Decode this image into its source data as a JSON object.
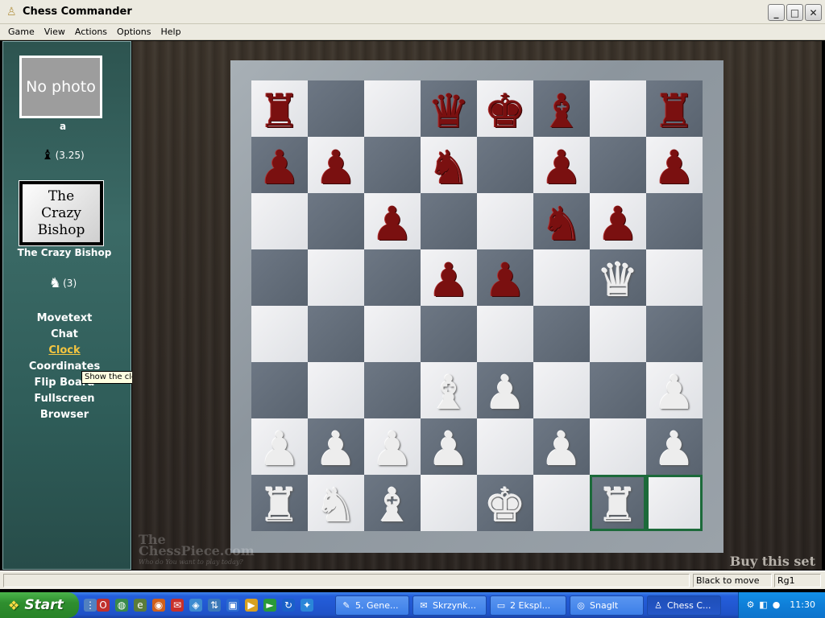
{
  "window": {
    "title": "Chess Commander",
    "controls": {
      "minimize": "_",
      "maximize": "□",
      "close": "✕"
    }
  },
  "menu": [
    "Game",
    "View",
    "Actions",
    "Options",
    "Help"
  ],
  "player1": {
    "photo_text": "No photo",
    "name": "a",
    "score": "(3.25)",
    "piece_icon": "bishop-icon"
  },
  "player2": {
    "picture_text": "The\nCrazy\nBishop",
    "name": "The Crazy Bishop",
    "score": "(3)",
    "piece_icon": "knight-icon"
  },
  "side_links": [
    "Movetext",
    "Chat",
    "Clock",
    "Coordinates",
    "Flip Board",
    "Fullscreen",
    "Browser"
  ],
  "active_link": "Clock",
  "tooltip": "Show the clock",
  "board": {
    "ranks": [
      [
        "r",
        "",
        "",
        "q",
        "k",
        "b",
        "",
        "r"
      ],
      [
        "p",
        "p",
        "",
        "n",
        "",
        "p",
        "",
        "p"
      ],
      [
        "",
        "",
        "p",
        "",
        "",
        "n",
        "p",
        ""
      ],
      [
        "",
        "",
        "",
        "p",
        "p",
        "",
        "Q",
        ""
      ],
      [
        "",
        "",
        "",
        "",
        "",
        "",
        "",
        ""
      ],
      [
        "",
        "",
        "",
        "B",
        "P",
        "",
        "",
        "P"
      ],
      [
        "P",
        "P",
        "P",
        "P",
        "",
        "P",
        "",
        "P"
      ],
      [
        "R",
        "N",
        "B",
        "",
        "K",
        "",
        "R",
        ""
      ]
    ],
    "highlight_squares": [
      "g1",
      "h1"
    ],
    "colors": {
      "highlight": "#1c6a3a",
      "black_pieces": "#7a1010",
      "white_pieces": "#ededed"
    }
  },
  "watermark": {
    "title": "The",
    "brand": "ChessPiece.com",
    "tagline": "Who do You want to play today?"
  },
  "buy_set": "Buy this set",
  "status": {
    "to_move": "Black to move",
    "last_move": "Rg1"
  },
  "taskbar": {
    "start": "Start",
    "quick_launch": [
      "opera-icon",
      "globe-icon",
      "ie-icon",
      "firefox-icon",
      "mail-icon",
      "vlc-icon",
      "ftp-icon",
      "folder-icon",
      "media-icon",
      "messenger-icon"
    ],
    "tasks": [
      {
        "label": "5. Gene...",
        "icon": "document-icon"
      },
      {
        "label": "Skrzynk...",
        "icon": "mail-icon"
      },
      {
        "label": "2 Ekspl...",
        "icon": "folder-icon"
      },
      {
        "label": "SnagIt",
        "icon": "snagit-icon"
      },
      {
        "label": "Chess C...",
        "icon": "chess-icon"
      }
    ],
    "clock": "11:30"
  }
}
